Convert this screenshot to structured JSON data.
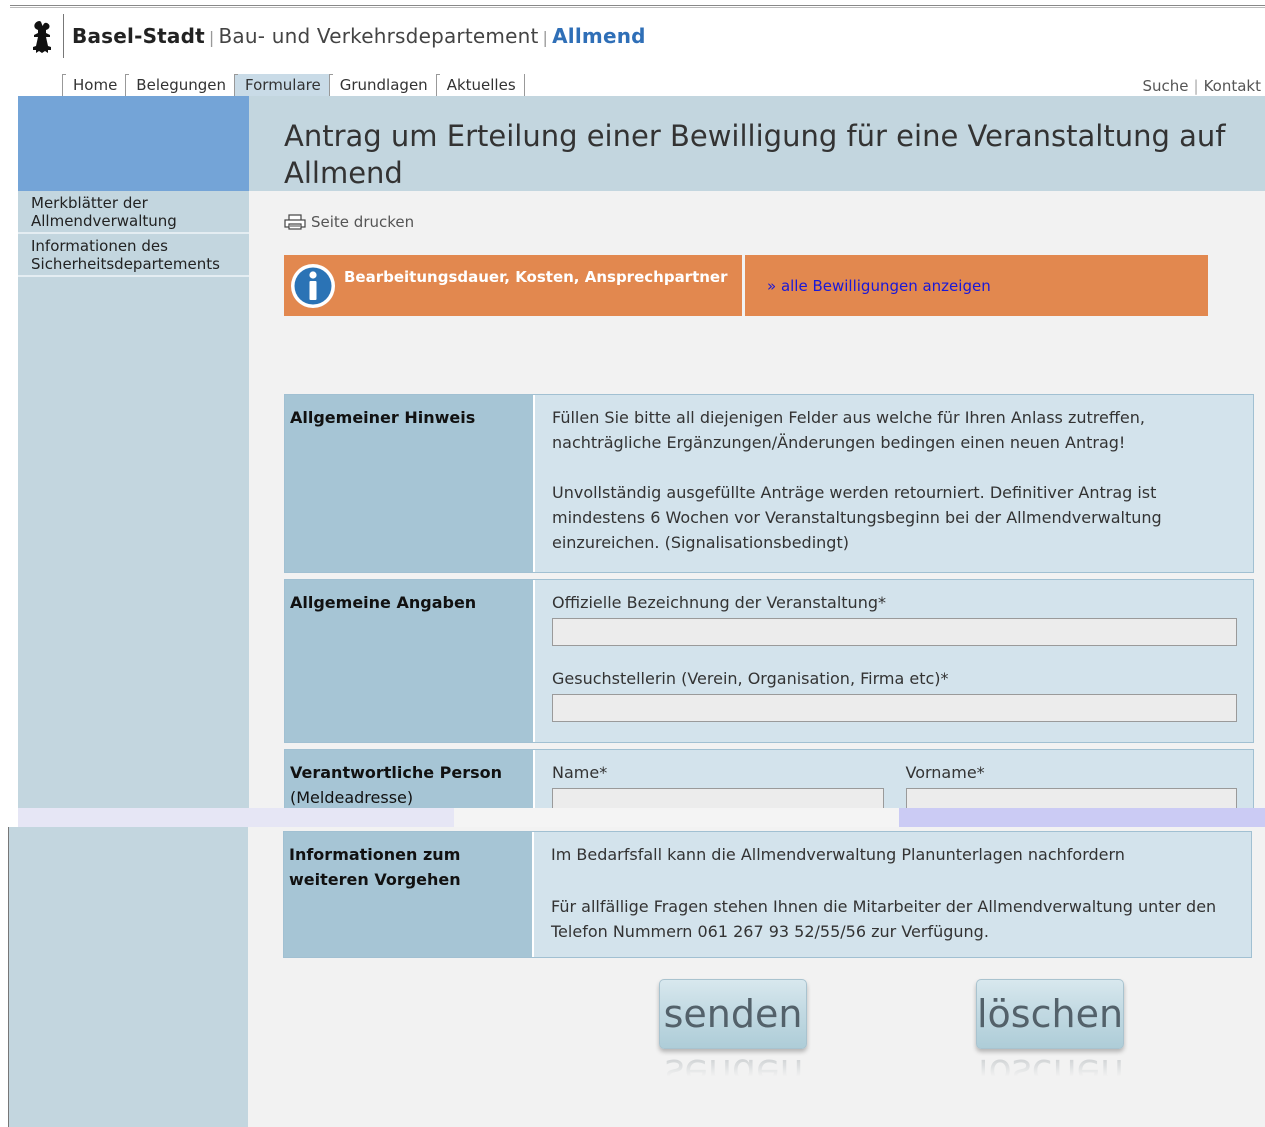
{
  "header": {
    "canton": "Basel-Stadt",
    "department": "Bau- und Verkehrsdepartement",
    "section": "Allmend"
  },
  "nav": {
    "items": [
      "Home",
      "Belegungen",
      "Formulare",
      "Grundlagen",
      "Aktuelles"
    ],
    "active": "Formulare",
    "search": "Suche",
    "contact": "Kontakt"
  },
  "page": {
    "title": "Antrag um Erteilung einer Bewilligung für eine Veranstaltung auf Allmend",
    "print_label": "Seite drucken"
  },
  "sidebar": {
    "links": [
      "Merkblätter der Allmendverwaltung",
      "Informationen des Sicherheitsdepartements"
    ]
  },
  "info_bar": {
    "label": "Bearbeitungsdauer, Kosten, Ansprechpartner",
    "link": "» alle Bewilligungen anzeigen"
  },
  "sections": {
    "hinweis": {
      "label": "Allgemeiner Hinweis",
      "text1": "Füllen Sie bitte all diejenigen Felder aus welche für Ihren Anlass zutreffen, nachträgliche Ergänzungen/Änderungen bedingen einen neuen Antrag!",
      "text2": "Unvollständig ausgefüllte Anträge werden retourniert. Definitiver Antrag ist mindestens 6 Wochen vor Veranstaltungsbeginn bei der Allmendverwaltung einzureichen. (Signalisationsbedingt)"
    },
    "angaben": {
      "label": "Allgemeine Angaben",
      "field1_label": "Offizielle Bezeichnung der Veranstaltung*",
      "field1_value": "",
      "field2_label": "Gesuchstellerin (Verein, Organisation, Firma etc)*",
      "field2_value": ""
    },
    "person": {
      "label": "Verantwortliche Person",
      "sublabel": "(Meldeadresse)",
      "name_label": "Name*",
      "vorname_label": "Vorname*"
    },
    "vorgehen": {
      "label": "Informationen zum weiteren Vorgehen",
      "text1": "Im Bedarfsfall kann die Allmendverwaltung Planunterlagen nachfordern",
      "text2": "Für allfällige Fragen stehen Ihnen die Mitarbeiter der Allmendverwaltung unter den Telefon Nummern 061 267 93 52/55/56 zur Verfügung."
    }
  },
  "buttons": {
    "send": "senden",
    "reset": "löschen"
  },
  "icons": {
    "logo": "basel-staff-icon",
    "print": "printer-icon",
    "info": "info-icon"
  },
  "colors": {
    "accent_orange": "#e2884f",
    "nav_blue": "#74a4d7",
    "panel_blue": "#c3d6df",
    "link_blue": "#1a18d8",
    "brand_blue": "#2f6fb7"
  }
}
